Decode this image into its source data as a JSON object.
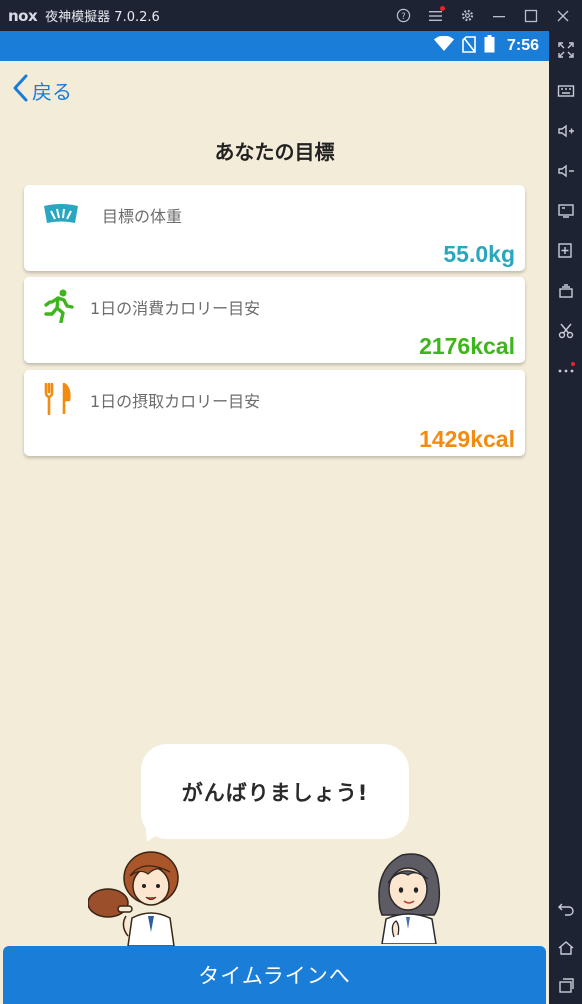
{
  "emulator": {
    "logo": "nox",
    "title": "夜神模擬器 7.0.2.6",
    "controls": [
      "help-icon",
      "menu-icon",
      "settings-icon",
      "minimize-icon",
      "maximize-icon",
      "close-icon"
    ],
    "side_tools": [
      "fullscreen-icon",
      "keyboard-icon",
      "volume-up-icon",
      "volume-down-icon",
      "screen-icon",
      "add-apk-icon",
      "multi-instance-icon",
      "screenshot-scissors-icon",
      "more-icon",
      "back-nav-icon",
      "home-nav-icon",
      "recent-apps-icon"
    ]
  },
  "status_bar": {
    "time": "7:56",
    "color": "#1a7dd8"
  },
  "header": {
    "back_label": "戻る",
    "title": "あなたの目標"
  },
  "goals": [
    {
      "label": "目標の体重",
      "value": "55.0kg",
      "color": "#2aa7c0",
      "icon": "weight-scale-icon"
    },
    {
      "label": "1日の消費カロリー目安",
      "value": "2176kcal",
      "color": "#3fb51d",
      "icon": "running-person-icon"
    },
    {
      "label": "1日の摂取カロリー目安",
      "value": "1429kcal",
      "color": "#f28b12",
      "icon": "fork-knife-icon"
    }
  ],
  "bubble": {
    "text": "がんばりましょう!"
  },
  "cta": {
    "label": "タイムラインへ"
  }
}
